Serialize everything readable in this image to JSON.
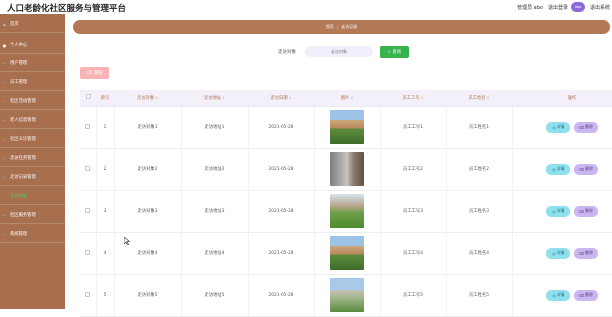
{
  "header": {
    "title": "人口老龄化社区服务与管理平台",
    "user_label": "管理员 abo",
    "logout_label": "退出登录",
    "avatar_text": "abo",
    "exit_label": "退出系统"
  },
  "sidebar": {
    "items": [
      {
        "label": "首页",
        "icon": "home-icon"
      },
      {
        "label": "个人中心",
        "icon": "user-icon"
      },
      {
        "label": "用户管理",
        "icon": "users-icon"
      },
      {
        "label": "员工管理",
        "icon": "staff-icon"
      },
      {
        "label": "社区活动管理",
        "icon": "calendar-icon"
      },
      {
        "label": "老人信息管理",
        "icon": "elder-icon"
      },
      {
        "label": "社区义诊管理",
        "icon": "medical-icon"
      },
      {
        "label": "走访任务管理",
        "icon": "task-icon"
      },
      {
        "label": "走访记录管理",
        "icon": "record-icon"
      },
      {
        "label": "走访记录",
        "icon": "dot-icon",
        "active": true
      },
      {
        "label": "社区服务管理",
        "icon": "service-icon"
      },
      {
        "label": "系统管理",
        "icon": "gear-icon"
      }
    ]
  },
  "breadcrumb": {
    "home": "首页",
    "current": "走访记录"
  },
  "search": {
    "label": "走访对象",
    "placeholder": "走访对象",
    "button_label": "查询"
  },
  "toolbar": {
    "delete_label": "删除"
  },
  "table": {
    "headers": [
      "索引",
      "走访对象",
      "走访地址",
      "走访日期",
      "图片",
      "员工工号",
      "员工姓名",
      "操作"
    ],
    "rows": [
      {
        "index": "1",
        "target": "走访对象1",
        "address": "走访地址1",
        "date": "2021-05-28",
        "emp_no": "员工工号1",
        "emp_name": "员工姓名1"
      },
      {
        "index": "2",
        "target": "走访对象2",
        "address": "走访地址2",
        "date": "2021-05-28",
        "emp_no": "员工工号2",
        "emp_name": "员工姓名2"
      },
      {
        "index": "3",
        "target": "走访对象3",
        "address": "走访地址3",
        "date": "2021-05-28",
        "emp_no": "员工工号3",
        "emp_name": "员工姓名3"
      },
      {
        "index": "4",
        "target": "走访对象4",
        "address": "走访地址4",
        "date": "2021-05-28",
        "emp_no": "员工工号4",
        "emp_name": "员工姓名4"
      },
      {
        "index": "5",
        "target": "走访对象5",
        "address": "走访地址5",
        "date": "2021-05-28",
        "emp_no": "员工工号5",
        "emp_name": "员工姓名5"
      }
    ],
    "detail_label": "详情",
    "delete_label": "删除"
  },
  "colors": {
    "sidebar": "#a86f4f",
    "breadcrumb": "#b37957",
    "search_button": "#37b24d",
    "delete_button": "#f8b4b4",
    "detail_button": "#8fe0ee",
    "row_delete_button": "#cbb7f0",
    "active_item": "#48d16b"
  }
}
